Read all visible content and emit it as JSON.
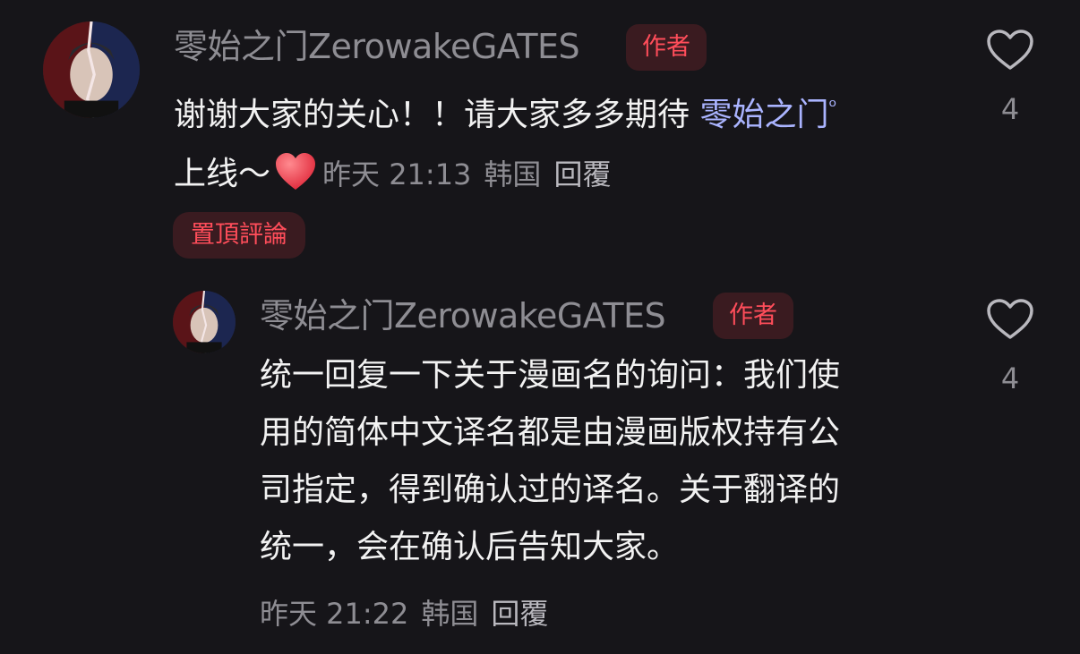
{
  "comments": [
    {
      "username": "零始之门ZerowakeGATES",
      "author_badge": "作者",
      "text_line1": "谢谢大家的关心！！请大家多多期待 ",
      "mention": "零始之门",
      "text_line2": "上线～",
      "time": "昨天 21:13",
      "location": "韩国",
      "reply_label": "回覆",
      "pinned_label": "置頂評論",
      "like_count": "4",
      "icon": "heart-outline-icon"
    },
    {
      "username": "零始之门ZerowakeGATES",
      "author_badge": "作者",
      "text_lines": [
        "统一回复一下关于漫画名的询问：我们使",
        "用的简体中文译名都是由漫画版权持有公",
        "司指定，得到确认过的译名。关于翻译的",
        "统一，会在确认后告知大家。"
      ],
      "time": "昨天 21:22",
      "location": "韩国",
      "reply_label": "回覆",
      "like_count": "4",
      "icon": "heart-outline-icon"
    }
  ],
  "colors": {
    "background": "#161519",
    "accent_red": "#ff4d5a",
    "mention_blue": "#aab4ff",
    "muted_gray": "#8e8d93"
  }
}
